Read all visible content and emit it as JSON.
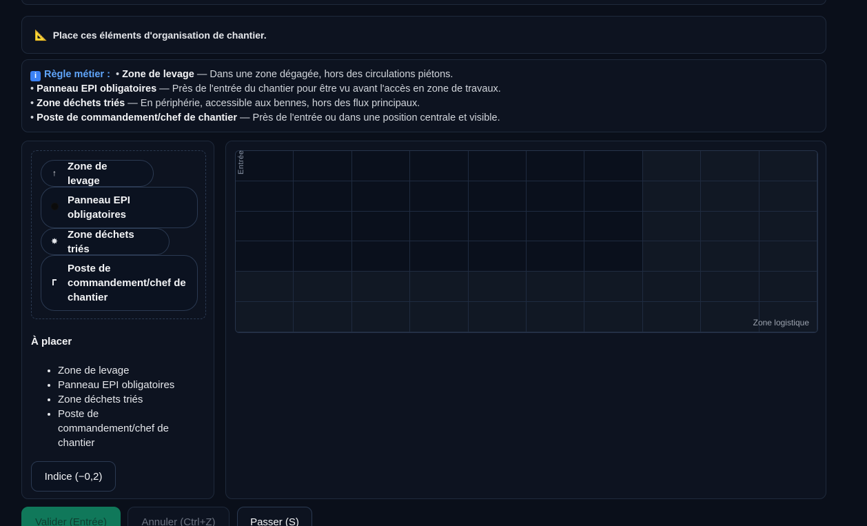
{
  "prompt": {
    "icon": "triangle-ruler-icon",
    "icon_glyph": "📐",
    "text": "Place ces éléments d'organisation de chantier."
  },
  "rule": {
    "icon_glyph": "i",
    "title": "Règle métier :",
    "items": [
      {
        "name": "Zone de levage",
        "text": " — Dans une zone dégagée, hors des circulations piétons."
      },
      {
        "name": "Panneau EPI obligatoires",
        "text": " — Près de l'entrée du chantier pour être vu avant l'accès en zone de travaux."
      },
      {
        "name": "Zone déchets triés",
        "text": " — En périphérie, accessible aux bennes, hors des flux principaux."
      },
      {
        "name": "Poste de commandement/chef de chantier",
        "text": " — Près de l'entrée ou dans une position centrale et visible."
      }
    ]
  },
  "palette": {
    "chips": [
      {
        "label": "Zone de levage",
        "icon": "arrow-up-icon",
        "glyph": "↑"
      },
      {
        "label": "Panneau EPI obligatoires",
        "icon": "circle-icon",
        "glyph": ""
      },
      {
        "label": "Zone déchets triés",
        "icon": "star-icon",
        "glyph": "✸"
      },
      {
        "label": "Poste de commandement/chef de chantier",
        "icon": "flag-icon",
        "glyph": ""
      }
    ]
  },
  "to_place": {
    "title": "À placer",
    "items": [
      "Zone de levage",
      "Panneau EPI obligatoires",
      "Zone déchets triés",
      "Poste de commandement/chef de chantier"
    ]
  },
  "hint_button": "Indice (−0,2)",
  "grid": {
    "rows": 6,
    "cols": 10,
    "entry_label": "Entrée",
    "logistics_label": "Zone logistique"
  },
  "actions": {
    "validate": "Valider (Entrée)",
    "cancel": "Annuler (Ctrl+Z)",
    "skip": "Passer (S)"
  }
}
